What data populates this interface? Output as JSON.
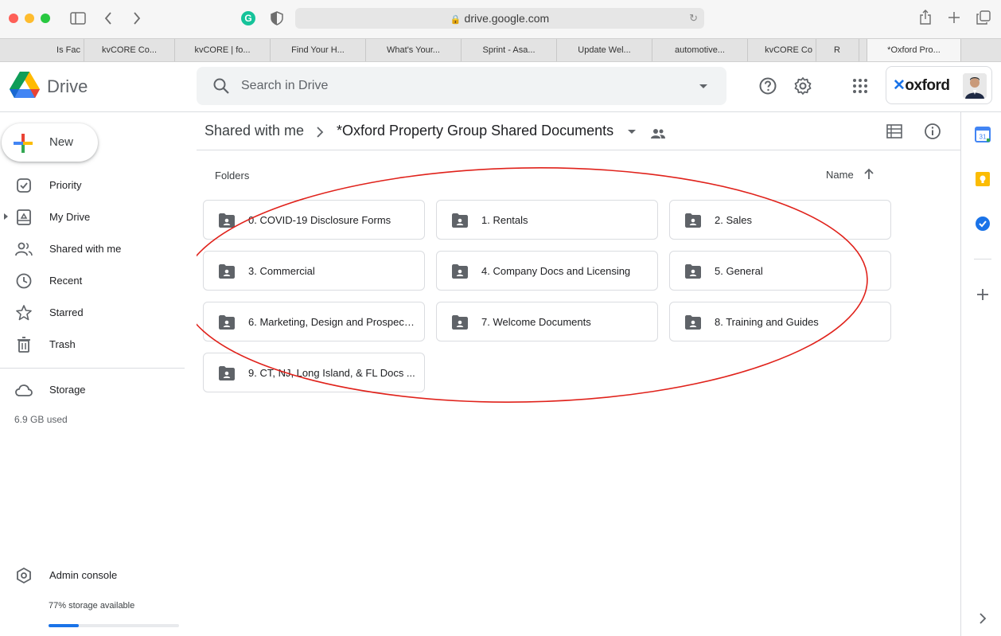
{
  "browser": {
    "url": "drive.google.com",
    "tabs": [
      "Is Fac",
      "kvCORE Co...",
      "kvCORE | fo...",
      "Find Your H...",
      "What's Your...",
      "Sprint - Asa...",
      "Update Wel...",
      "automotive...",
      "kvCORE Co",
      "R",
      "*Oxford Pro..."
    ]
  },
  "header": {
    "app_name": "Drive",
    "search_placeholder": "Search in Drive",
    "account_brand": "oxford"
  },
  "sidebar": {
    "new_label": "New",
    "items": [
      {
        "label": "Priority",
        "icon": "priority-icon"
      },
      {
        "label": "My Drive",
        "icon": "my-drive-icon"
      },
      {
        "label": "Shared with me",
        "icon": "shared-with-me-icon"
      },
      {
        "label": "Recent",
        "icon": "clock-icon"
      },
      {
        "label": "Starred",
        "icon": "star-icon"
      },
      {
        "label": "Trash",
        "icon": "trash-icon"
      }
    ],
    "storage_label": "Storage",
    "storage_used": "6.9 GB used",
    "admin_label": "Admin console",
    "storage_available": "77% storage available",
    "storage_fill_fraction": 0.23
  },
  "main": {
    "breadcrumb_root": "Shared with me",
    "breadcrumb_current": "*Oxford Property Group Shared Documents",
    "folders_heading": "Folders",
    "sort_label": "Name",
    "folders": [
      "0. COVID-19 Disclosure Forms",
      "1. Rentals",
      "2. Sales",
      "3. Commercial",
      "4. Company Docs and Licensing",
      "5. General",
      "6. Marketing, Design and Prospect...",
      "7. Welcome Documents",
      "8. Training and Guides",
      "9. CT, NJ, Long Island, & FL Docs ..."
    ]
  },
  "colors": {
    "accent": "#1a73e8",
    "annotation": "#e0221b"
  }
}
